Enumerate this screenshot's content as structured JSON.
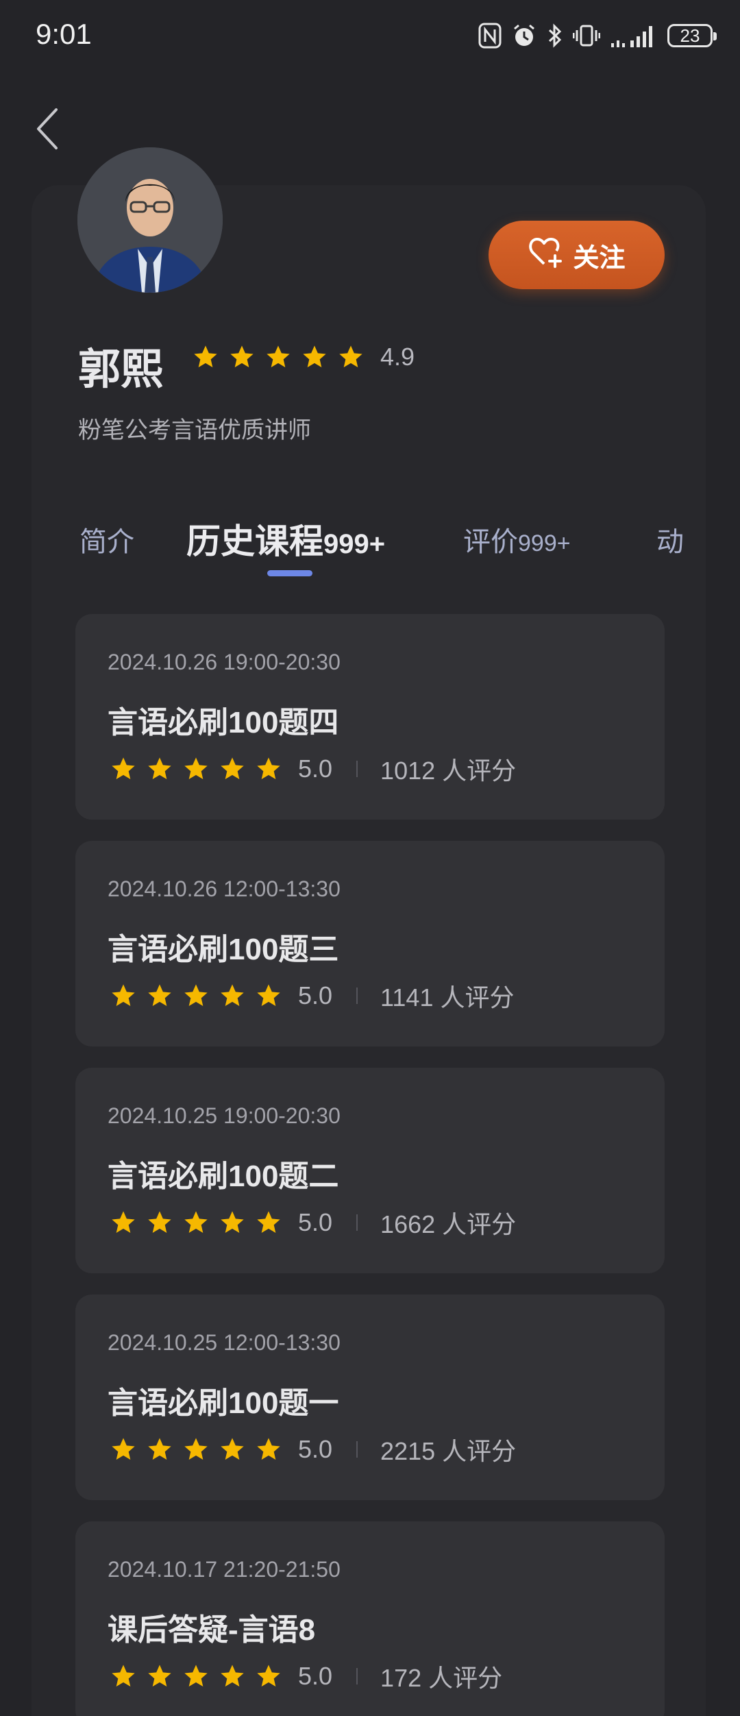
{
  "status_bar": {
    "time": "9:01",
    "battery": "23"
  },
  "teacher": {
    "name": "郭熙",
    "rating": "4.9",
    "title": "粉笔公考言语优质讲师",
    "follow_label": "关注"
  },
  "tabs": {
    "intro": "简介",
    "history": "历史课程",
    "history_count": "999+",
    "reviews": "评价",
    "reviews_count": "999+",
    "dynamics": "动"
  },
  "courses": [
    {
      "time": "2024.10.26 19:00-20:30",
      "name": "言语必刷100题四",
      "score": "5.0",
      "count": "1012 人评分"
    },
    {
      "time": "2024.10.26 12:00-13:30",
      "name": "言语必刷100题三",
      "score": "5.0",
      "count": "1141 人评分"
    },
    {
      "time": "2024.10.25 19:00-20:30",
      "name": "言语必刷100题二",
      "score": "5.0",
      "count": "1662 人评分"
    },
    {
      "time": "2024.10.25 12:00-13:30",
      "name": "言语必刷100题一",
      "score": "5.0",
      "count": "2215 人评分"
    },
    {
      "time": "2024.10.17 21:20-21:50",
      "name": "课后答疑-言语8",
      "score": "5.0",
      "count": "172 人评分"
    }
  ],
  "colors": {
    "accent": "#6d87e6",
    "follow": "#d8642a",
    "star": "#f6b800"
  },
  "icons": [
    "back-icon",
    "nfc-icon",
    "alarm-icon",
    "bluetooth-icon",
    "vibrate-icon",
    "signal-icon",
    "battery-icon",
    "heart-plus-icon",
    "star-icon"
  ]
}
